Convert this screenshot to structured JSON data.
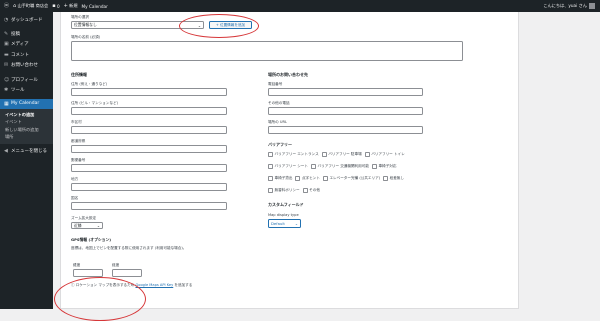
{
  "admin_bar": {
    "site_name": "山手町職 商店会",
    "comments_count": "0",
    "new_label": "新規",
    "plugin_label": "My Calendar",
    "greeting": "こんにちは、yuai さん"
  },
  "sidebar": {
    "items": [
      {
        "label": "ダッシュボード",
        "icon": "gauge-icon"
      },
      {
        "label": "投稿",
        "icon": "pin-icon"
      },
      {
        "label": "メディア",
        "icon": "media-icon"
      },
      {
        "label": "コメント",
        "icon": "comment-icon"
      },
      {
        "label": "お問い合わせ",
        "icon": "mail-icon"
      },
      {
        "label": "プロフィール",
        "icon": "user-icon"
      },
      {
        "label": "ツール",
        "icon": "wrench-icon"
      },
      {
        "label": "My Calendar",
        "icon": "calendar-icon"
      }
    ],
    "submenu": [
      "イベントの追加",
      "イベント",
      "新しい場所の追加",
      "場所"
    ],
    "collapse_label": "メニューを閉じる"
  },
  "form": {
    "location_select_label": "場所の選択",
    "location_select_value": "位置情報なし",
    "add_location_button": "+ 位置情報を追加",
    "location_name_label": "場所の名前 (必須)",
    "location_info_heading": "住所情報",
    "contact_heading": "場所のお問い合わせ先",
    "street_label": "住所 (例え・通りなど)",
    "street2_label": "住所 (ビル・マンションなど)",
    "city_label": "市区村",
    "state_label": "都道府県",
    "postcode_label": "郵便番号",
    "region_label": "地方",
    "country_label": "国名",
    "zoom_label": "ズーム拡大設定",
    "zoom_value": "近隣",
    "phone_label": "電話番号",
    "phone2_label": "その他の電話",
    "url_label": "場所の URL",
    "accessibility_heading": "バリアフリー",
    "accessibility_options": [
      [
        "バリアフリー エントランス",
        "バリアフリー 駐車場",
        "バリアフリー トイレ"
      ],
      [
        "バリアフリー シート",
        "バリアフリー 交通機関利用可能",
        "車椅子対応"
      ],
      [
        "車椅子貸出",
        "点字ヒント",
        "エレベーター完備 (公共エリア)",
        "段差無し"
      ],
      [
        "無香料ポリシー",
        "その他"
      ]
    ],
    "custom_fields_heading": "カスタムフィールド",
    "map_display_label": "Map display type",
    "map_display_value": "Default",
    "gps_heading": "GPS情報 (オプション)",
    "gps_note": "座標は、地図上でピンを配置する際に使用されます (利用可能な場合)。",
    "latitude_label": "緯度",
    "longitude_label": "経度",
    "footer_prefix": "ロケーション マップを表示するため",
    "footer_link": "Google Maps API Key",
    "footer_suffix": "を追加する"
  },
  "colors": {
    "admin_dark": "#1d2327",
    "accent": "#2271b1",
    "annotation": "#d63638"
  }
}
